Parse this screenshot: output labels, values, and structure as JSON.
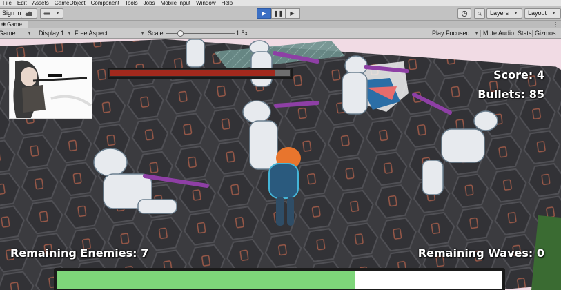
{
  "menu": [
    "File",
    "Edit",
    "Assets",
    "GameObject",
    "Component",
    "Tools",
    "Jobs",
    "Mobile Input",
    "Window",
    "Help"
  ],
  "toolbar": {
    "sign_in": "Sign in",
    "layers": "Layers",
    "layout": "Layout"
  },
  "tab": {
    "label": "Game"
  },
  "gamebar": {
    "mode": "Game",
    "display": "Display 1",
    "aspect": "Free Aspect",
    "scale_label": "Scale",
    "scale_value": "1.5x",
    "play_focused": "Play Focused",
    "mute_audio": "Mute Audio",
    "stats": "Stats",
    "gizmos": "Gizmos"
  },
  "hud": {
    "score": "Score: 4",
    "bullets": "Bullets: 85",
    "remaining_enemies": "Remaining Enemies: 7",
    "remaining_waves": "Remaining Waves: 0",
    "enemy_health_fraction": 0.92,
    "player_health_fraction": 0.67
  },
  "colors": {
    "play_active": "#3b6fc4",
    "enemy_bar": "#a2291d",
    "health_bar": "#7ed67a",
    "floor": "#3a3a3e",
    "floor_bg": "#f1dbe4"
  }
}
